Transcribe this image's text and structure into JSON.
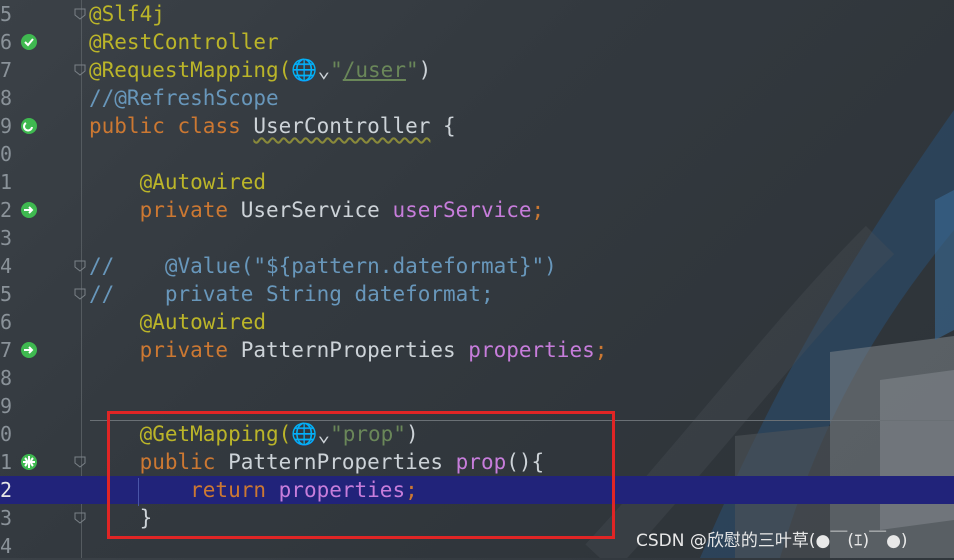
{
  "editor": {
    "lines": [
      {
        "num": "5",
        "gutter": "",
        "fold": true,
        "tokens": [
          {
            "t": "@Slf4j",
            "c": "ann"
          }
        ]
      },
      {
        "num": "6",
        "gutter": "bean",
        "fold": false,
        "tokens": [
          {
            "t": "@RestController",
            "c": "ann"
          }
        ]
      },
      {
        "num": "7",
        "gutter": "",
        "fold": true,
        "tokens": [
          {
            "t": "@RequestMapping(",
            "c": "ann"
          },
          {
            "t": "🌐⌄",
            "c": "plain"
          },
          {
            "t": "\"",
            "c": "str"
          },
          {
            "t": "/user",
            "c": "strlink"
          },
          {
            "t": "\"",
            "c": "str"
          },
          {
            "t": ")",
            "c": "plain"
          }
        ]
      },
      {
        "num": "8",
        "gutter": "",
        "fold": false,
        "tokens": [
          {
            "t": "//@RefreshScope",
            "c": "cmt"
          }
        ]
      },
      {
        "num": "9",
        "gutter": "web",
        "fold": false,
        "tokens": [
          {
            "t": "public ",
            "c": "kw"
          },
          {
            "t": "class ",
            "c": "kw"
          },
          {
            "t": "UserController",
            "c": "plain wavy"
          },
          {
            "t": " {",
            "c": "plain"
          }
        ]
      },
      {
        "num": "0",
        "gutter": "",
        "fold": false,
        "tokens": []
      },
      {
        "num": "1",
        "gutter": "",
        "fold": false,
        "tokens": [
          {
            "t": "    @Autowired",
            "c": "ann"
          }
        ]
      },
      {
        "num": "2",
        "gutter": "inject",
        "fold": false,
        "tokens": [
          {
            "t": "    private ",
            "c": "kw"
          },
          {
            "t": "UserService ",
            "c": "plain"
          },
          {
            "t": "userService",
            "c": "field"
          },
          {
            "t": ";",
            "c": "kw"
          }
        ]
      },
      {
        "num": "3",
        "gutter": "",
        "fold": false,
        "tokens": []
      },
      {
        "num": "4",
        "gutter": "",
        "fold": true,
        "tokens": [
          {
            "t": "//",
            "c": "cmt"
          },
          {
            "t": "    @Value(\"${pattern.dateformat}\")",
            "c": "cmt"
          }
        ]
      },
      {
        "num": "5",
        "gutter": "",
        "fold": true,
        "tokens": [
          {
            "t": "//",
            "c": "cmt"
          },
          {
            "t": "    private String dateformat;",
            "c": "cmt"
          }
        ]
      },
      {
        "num": "6",
        "gutter": "",
        "fold": false,
        "tokens": [
          {
            "t": "    @Autowired",
            "c": "ann"
          }
        ]
      },
      {
        "num": "7",
        "gutter": "inject",
        "fold": false,
        "tokens": [
          {
            "t": "    private ",
            "c": "kw"
          },
          {
            "t": "PatternProperties ",
            "c": "plain"
          },
          {
            "t": "properties",
            "c": "field"
          },
          {
            "t": ";",
            "c": "kw"
          }
        ]
      },
      {
        "num": "8",
        "gutter": "",
        "fold": false,
        "tokens": []
      },
      {
        "num": "9",
        "gutter": "",
        "fold": false,
        "tokens": []
      },
      {
        "num": "0",
        "gutter": "",
        "fold": false,
        "tokens": [
          {
            "t": "    @GetMapping(",
            "c": "ann"
          },
          {
            "t": "🌐⌄",
            "c": "plain"
          },
          {
            "t": "\"prop\"",
            "c": "str"
          },
          {
            "t": ")",
            "c": "plain"
          }
        ]
      },
      {
        "num": "1",
        "gutter": "globe",
        "fold": true,
        "tokens": [
          {
            "t": "    public ",
            "c": "kw"
          },
          {
            "t": "PatternProperties ",
            "c": "plain"
          },
          {
            "t": "prop",
            "c": "field"
          },
          {
            "t": "(){",
            "c": "plain"
          }
        ]
      },
      {
        "num": "2",
        "gutter": "",
        "fold": false,
        "current": true,
        "tokens": [
          {
            "t": "        return ",
            "c": "kw"
          },
          {
            "t": "properties",
            "c": "field"
          },
          {
            "t": ";",
            "c": "kw"
          }
        ]
      },
      {
        "num": "3",
        "gutter": "",
        "fold": true,
        "tokens": [
          {
            "t": "    }",
            "c": "plain"
          }
        ]
      },
      {
        "num": "4",
        "gutter": "",
        "fold": false,
        "tokens": []
      }
    ]
  },
  "watermark": "CSDN @欣慰的三叶草(●￣(ｴ)￣●)",
  "colors": {
    "gutter_icon": "#3fb950",
    "highlight_box": "#e02525",
    "current_line": "#21237a"
  }
}
